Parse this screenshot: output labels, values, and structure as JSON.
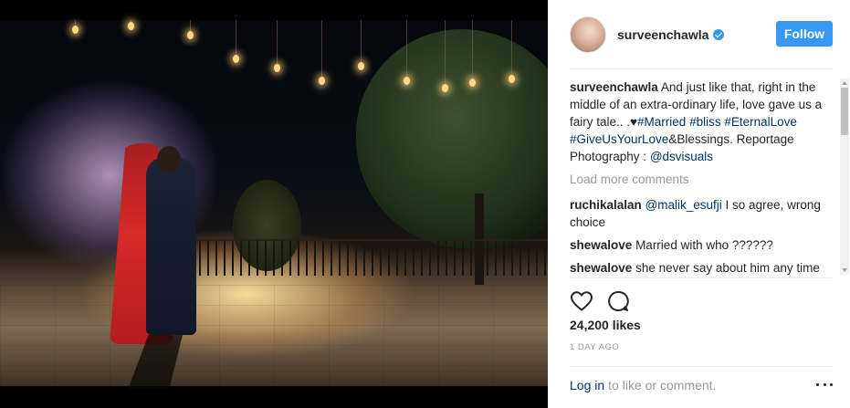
{
  "post": {
    "author": {
      "username": "surveenchawla",
      "verified": true
    },
    "follow_label": "Follow",
    "caption": {
      "username": "surveenchawla",
      "text_parts": [
        {
          "t": "And just like that, right in the middle of an extra-ordinary life, love gave us a fairy tale.. .",
          "type": "text"
        },
        {
          "t": "♥",
          "type": "text"
        },
        {
          "t": "#Married",
          "type": "hashtag"
        },
        {
          "t": " ",
          "type": "text"
        },
        {
          "t": "#bliss",
          "type": "hashtag"
        },
        {
          "t": " ",
          "type": "text"
        },
        {
          "t": "#EternalLove",
          "type": "hashtag"
        },
        {
          "t": " ",
          "type": "text"
        },
        {
          "t": "#GiveUsYourLove",
          "type": "hashtag"
        },
        {
          "t": "&Blessings. Reportage Photography : ",
          "type": "text"
        },
        {
          "t": "@dsvisuals",
          "type": "mention"
        }
      ]
    },
    "load_more_label": "Load more comments",
    "comments": [
      {
        "username": "ruchikalalan",
        "mention": "@malik_esufji",
        "text": " I so agree, wrong choice"
      },
      {
        "username": "shewalove",
        "mention": "",
        "text": "Married with who ??????"
      },
      {
        "username": "shewalove",
        "mention": "",
        "text": "she never say about him any time lol 😂"
      }
    ],
    "actions": {
      "like_icon": "heart-icon",
      "comment_icon": "comment-icon"
    },
    "likes": "24,200 likes",
    "time": "1 DAY AGO",
    "footer": {
      "login_label": "Log in",
      "rest_label": "to like or comment.",
      "more_icon": "more-options-icon"
    },
    "colors": {
      "follow_bg": "#3897f0",
      "link": "#003569",
      "muted": "#999999"
    }
  }
}
